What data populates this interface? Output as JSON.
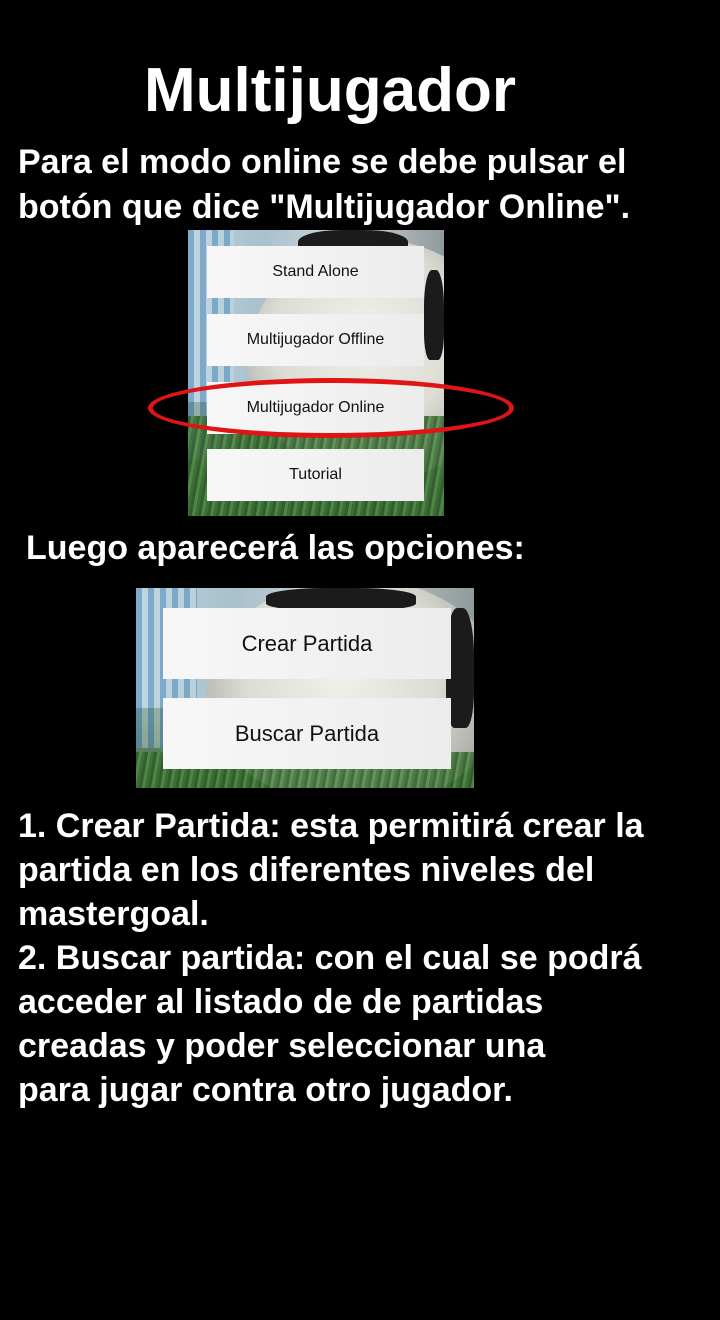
{
  "title": "Multijugador",
  "intro": {
    "line1": "Para el modo online se debe pulsar el",
    "line2": "botón que dice \"Multijugador Online\"."
  },
  "main_menu": {
    "buttons": [
      {
        "label": "Stand Alone"
      },
      {
        "label": "Multijugador Offline"
      },
      {
        "label": "Multijugador Online",
        "highlighted": true
      },
      {
        "label": "Tutorial"
      }
    ],
    "highlight_color": "#e01414"
  },
  "options_heading": "Luego aparecerá las opciones:",
  "online_menu": {
    "buttons": [
      {
        "label": "Crear Partida"
      },
      {
        "label": "Buscar Partida"
      }
    ]
  },
  "description": {
    "lines": [
      "1. Crear Partida: esta permitirá crear la",
      "partida en los diferentes niveles del",
      "mastergoal.",
      "2. Buscar partida: con el cual se podrá",
      "acceder al listado de de partidas",
      "creadas y poder seleccionar una",
      "para jugar contra otro jugador."
    ]
  },
  "colors": {
    "background": "#000000",
    "text": "#ffffff",
    "button_bg": "#f2f2f2",
    "button_text": "#111111"
  }
}
